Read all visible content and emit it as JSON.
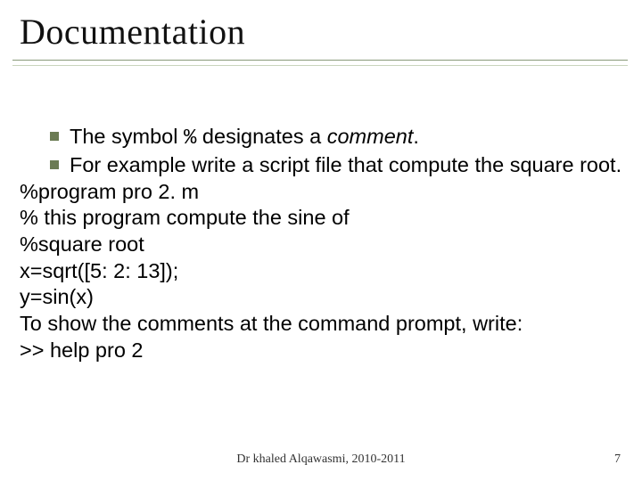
{
  "title": "Documentation",
  "bullets": {
    "b1_pre": "The symbol ",
    "b1_sym": "%",
    "b1_mid": " designates a ",
    "b1_comment": "comment",
    "b1_post": ".",
    "b2": "For example write a script file that compute the square root."
  },
  "lines": {
    "l1": "%program pro 2. m",
    "l2": "% this program compute the sine of",
    "l3": "%square root",
    "l4": "x=sqrt([5: 2: 13]);",
    "l5": "y=sin(x)",
    "l6": "To show the comments at the command prompt, write:",
    "l7": ">> help pro 2"
  },
  "footer": {
    "center": "Dr khaled Alqawasmi, 2010-2011",
    "page": "7"
  }
}
